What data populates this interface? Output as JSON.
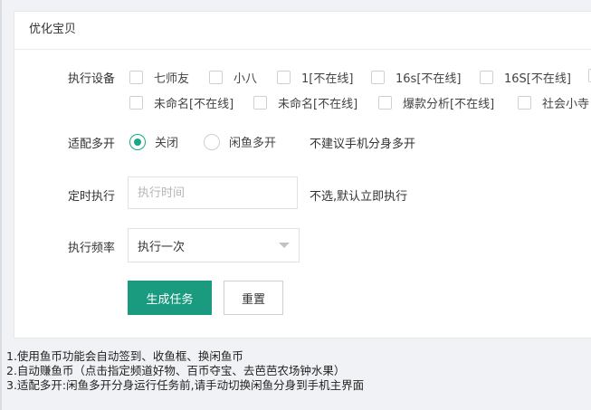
{
  "card": {
    "title": "优化宝贝"
  },
  "form": {
    "devices": {
      "label": "执行设备",
      "options": [
        {
          "label": "七师友",
          "checked": false
        },
        {
          "label": "小八",
          "checked": false
        },
        {
          "label": "1[不在线]",
          "checked": false
        },
        {
          "label": "16s[不在线]",
          "checked": false
        },
        {
          "label": "16S[不在线]",
          "checked": false
        },
        {
          "label": "未命名[不在线]",
          "checked": false
        },
        {
          "label": "未命名[不在线]",
          "checked": false
        },
        {
          "label": "爆款分析[不在线]",
          "checked": false
        },
        {
          "label": "社会小寺",
          "checked": false
        }
      ]
    },
    "multi": {
      "label": "适配多开",
      "options": [
        {
          "label": "关闭",
          "selected": true
        },
        {
          "label": "闲鱼多开",
          "selected": false
        }
      ],
      "hint": "不建议手机分身多开"
    },
    "schedule": {
      "label": "定时执行",
      "placeholder": "执行时间",
      "value": "",
      "hint": "不选,默认立即执行"
    },
    "frequency": {
      "label": "执行频率",
      "value": "执行一次"
    },
    "buttons": {
      "generate": "生成任务",
      "reset": "重置"
    }
  },
  "notes": [
    "1.使用鱼币功能会自动签到、收鱼框、换闲鱼币",
    "2.自动赚鱼币（点击指定频道好物、百币夺宝、去芭芭农场钟水果）",
    "3.适配多开:闲鱼多开分身运行任务前,请手动切换闲鱼分身到手机主界面"
  ],
  "colors": {
    "accent": "#1a9b80"
  }
}
